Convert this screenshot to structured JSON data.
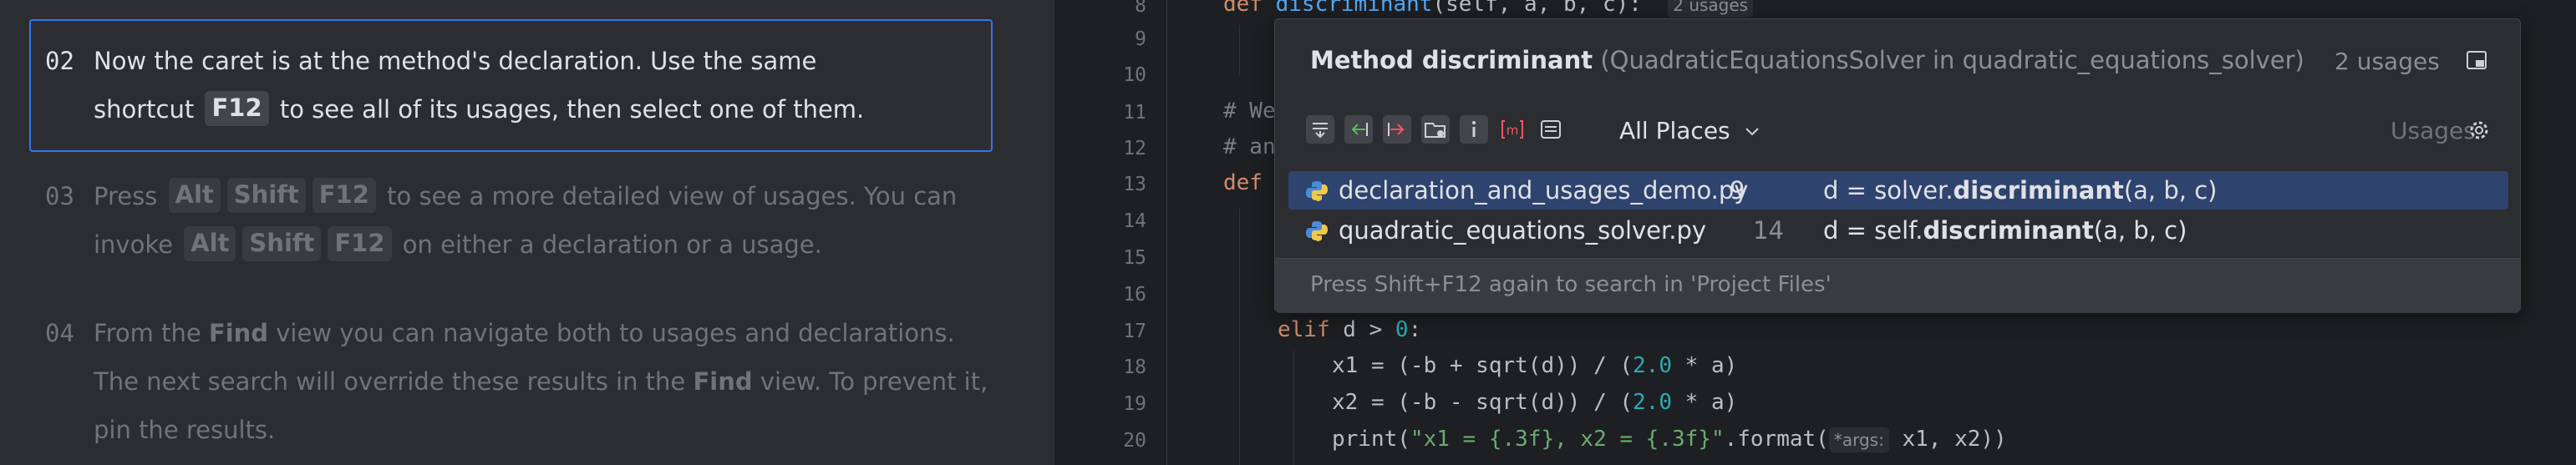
{
  "steps": [
    {
      "num": "02",
      "line1": "Now the caret is at the method's declaration. Use the same",
      "line2_before": "shortcut",
      "line2_key": "F12",
      "line2_after": "to see all of its usages, then select one of them."
    },
    {
      "num": "03",
      "line1_before": "Press",
      "line1_keys": [
        "Alt",
        "Shift",
        "F12"
      ],
      "line1_after": "to see a more detailed view of usages. You can",
      "line2_before": "invoke",
      "line2_keys": [
        "Alt",
        "Shift",
        "F12"
      ],
      "line2_after": "on either a declaration or a usage."
    },
    {
      "num": "04",
      "line1_before": "From the",
      "line1_bold": "Find",
      "line1_after": "view you can navigate both to usages and declarations.",
      "line2_before": "The next search will override these results in the",
      "line2_bold": "Find",
      "line2_after": "view. To prevent it,",
      "line3": "pin the results."
    }
  ],
  "editor": {
    "line_numbers": [
      "8",
      "9",
      "10",
      "11",
      "12",
      "13",
      "14",
      "15",
      "16",
      "17",
      "18",
      "19",
      "20"
    ],
    "line8": {
      "kw": "def",
      "fn": "discriminant",
      "args": "(self, a, b, c):",
      "hint": "2 usages"
    },
    "line11": "# We",
    "line12": "# an",
    "line13_kw": "def",
    "line17": {
      "kw": "elif",
      "rest1": " d > ",
      "num": "0",
      "rest2": ":"
    },
    "line18": {
      "a": "x1 = (-b + sqrt(d)) / (",
      "num": "2.0",
      "b": " * a)"
    },
    "line19": {
      "a": "x2 = (-b - sqrt(d)) / (",
      "num": "2.0",
      "b": " * a)"
    },
    "line20": {
      "a": "print(",
      "str": "\"x1 = {.3f}, x2 = {.3f}\"",
      "b": ".format(",
      "hint": "*args:",
      "c": " x1, x2))"
    }
  },
  "popup": {
    "title_main": "Method discriminant",
    "title_context": "(QuadraticEquationsSolver in quadratic_equations_solver)",
    "count": "2 usages",
    "scope": "All Places",
    "usages_label": "Usages",
    "toolbar_icons": [
      "merge-lines-icon",
      "navigate-in-icon",
      "navigate-out-icon",
      "folder-settings-icon",
      "info-icon",
      "method-icon",
      "preview-icon"
    ],
    "results": [
      {
        "file": "declaration_and_usages_demo.py",
        "line": "9",
        "code_before": "d = solver.",
        "code_bold": "discriminant",
        "code_after": "(a, b, c)"
      },
      {
        "file": "quadratic_equations_solver.py",
        "line": "14",
        "code_before": "d = self.",
        "code_bold": "discriminant",
        "code_after": "(a, b, c)"
      }
    ],
    "footer": "Press Shift+F12 again to search in 'Project Files'"
  },
  "colors": {
    "accent": "#3574f0",
    "selection": "#2e436e",
    "keyword": "#cf8e6d",
    "function": "#56a8f5",
    "number": "#2aacb8",
    "string": "#6aab73"
  }
}
